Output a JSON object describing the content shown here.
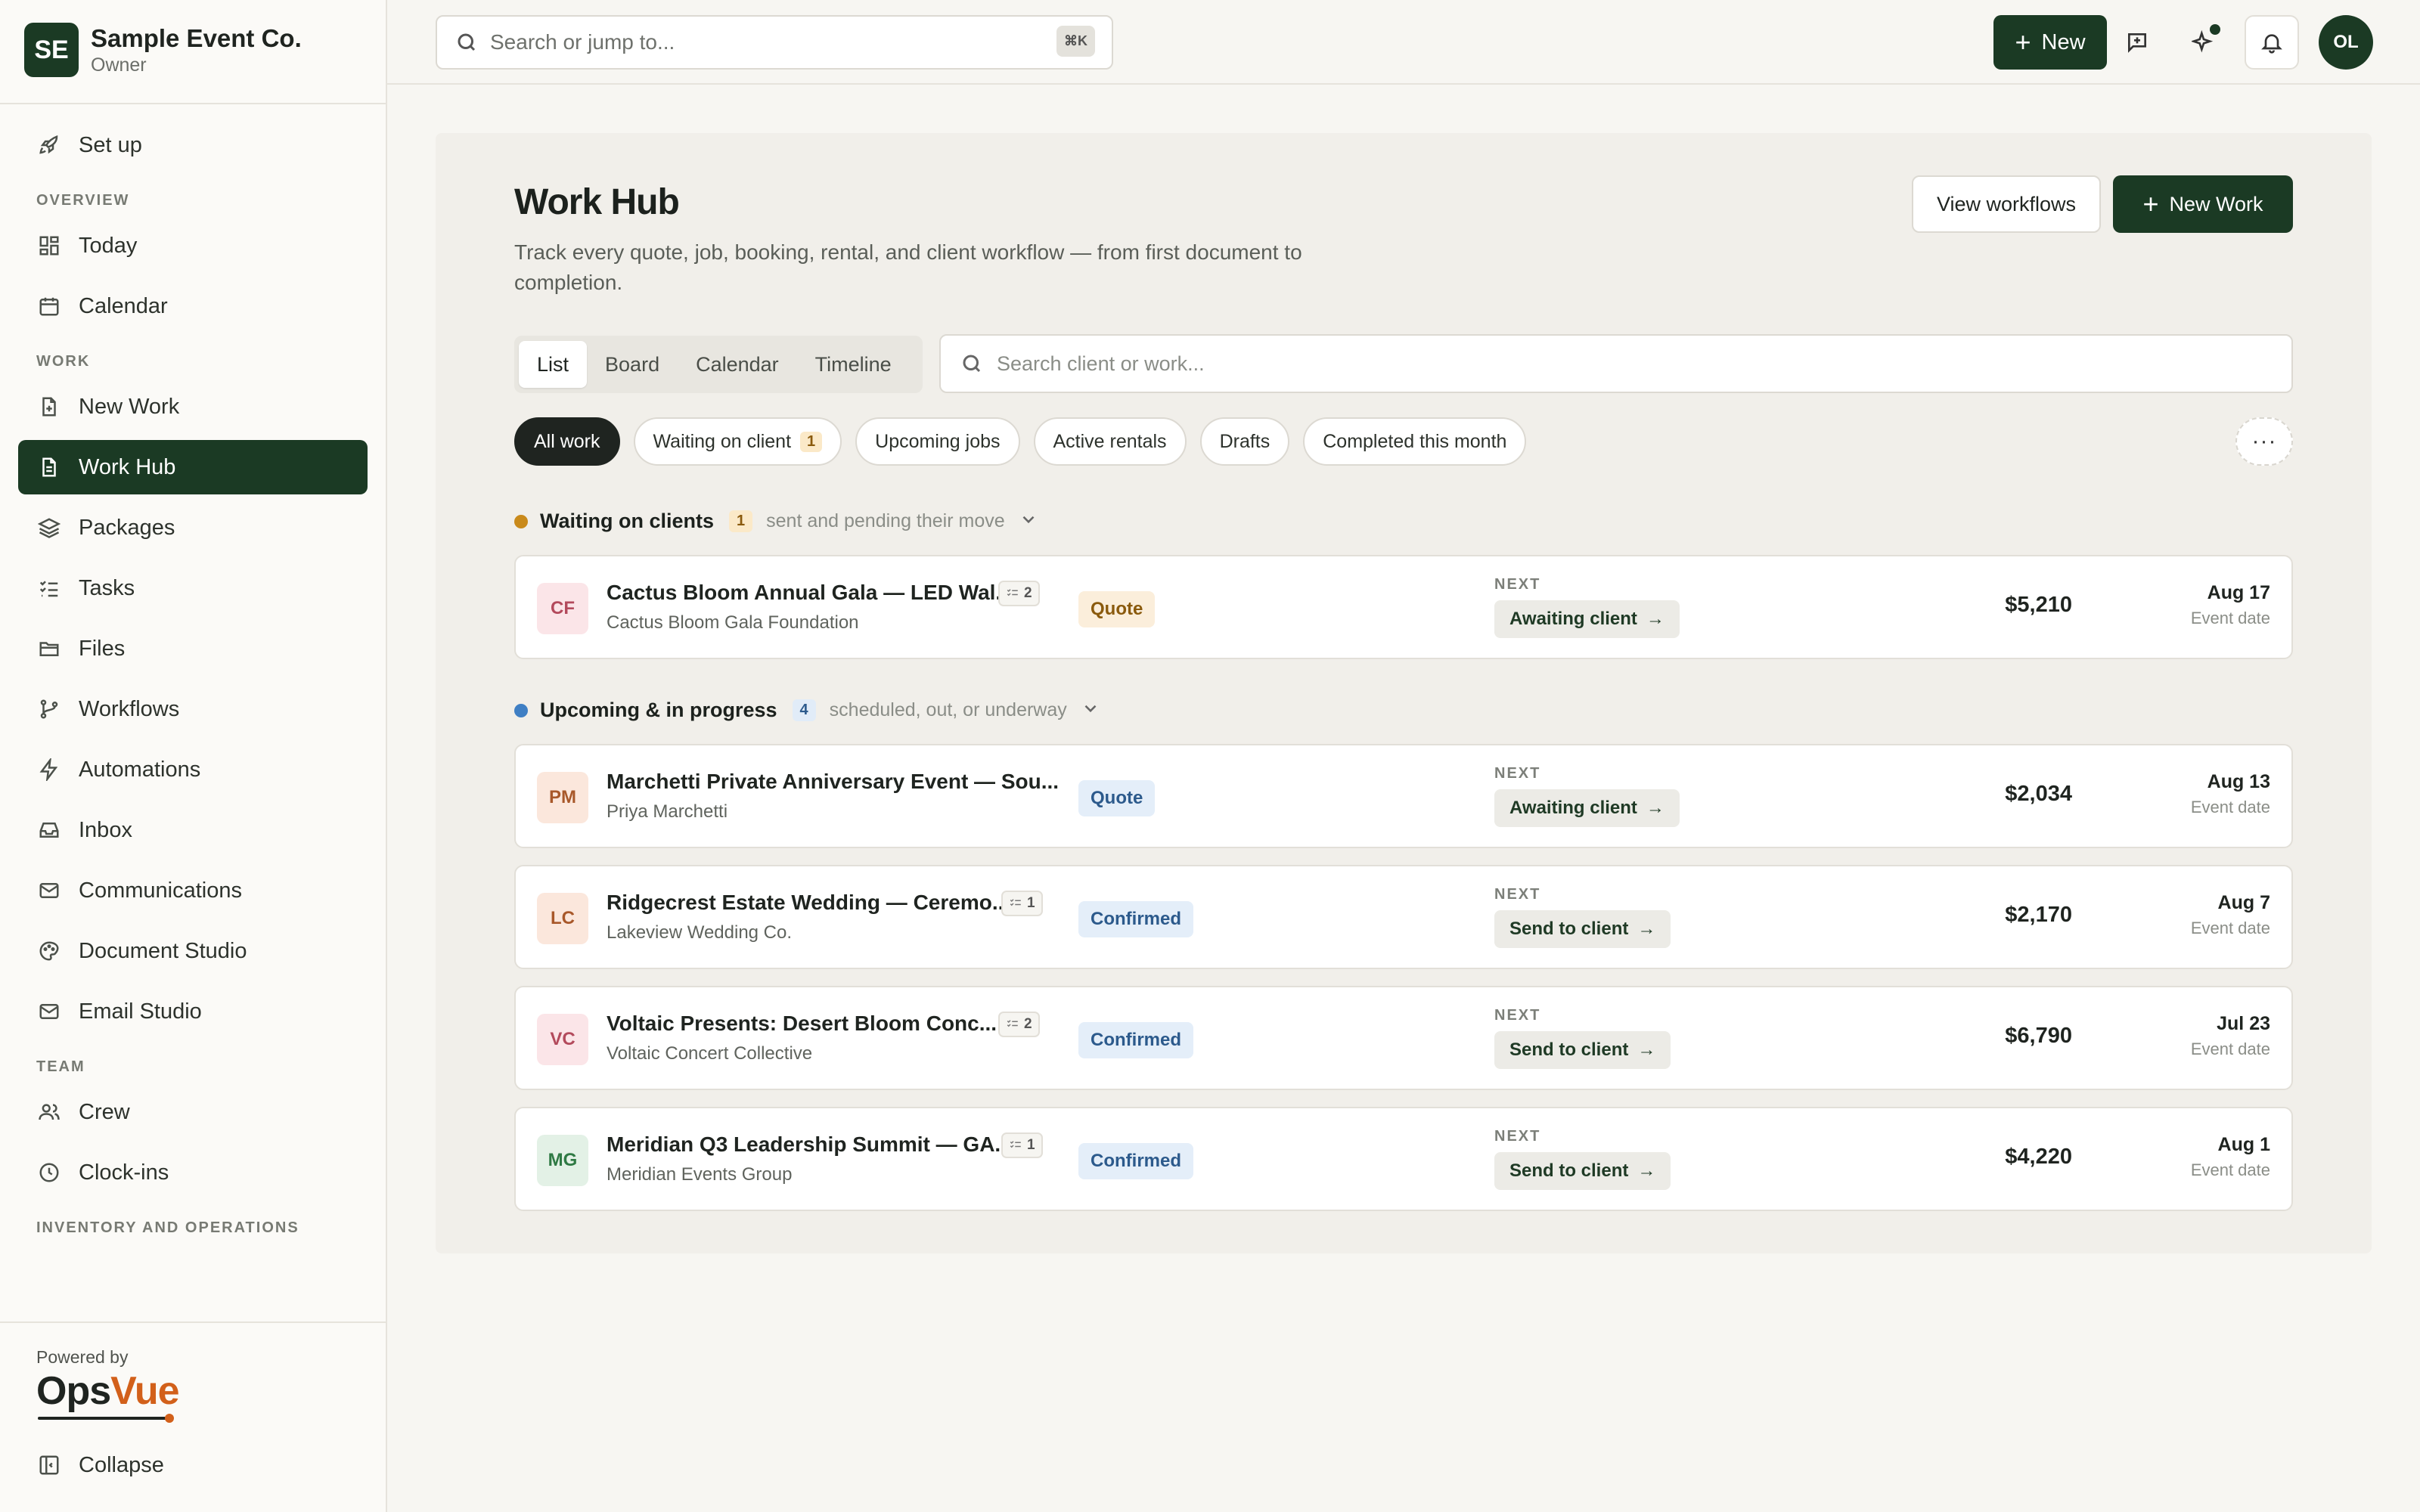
{
  "org": {
    "initials": "SE",
    "name": "Sample Event Co.",
    "role": "Owner"
  },
  "nav": {
    "setup": "Set up",
    "overview_section": "OVERVIEW",
    "today": "Today",
    "calendar": "Calendar",
    "work_section": "WORK",
    "new_work": "New Work",
    "work_hub": "Work Hub",
    "packages": "Packages",
    "tasks": "Tasks",
    "files": "Files",
    "workflows": "Workflows",
    "automations": "Automations",
    "inbox": "Inbox",
    "communications": "Communications",
    "document_studio": "Document Studio",
    "email_studio": "Email Studio",
    "team_section": "TEAM",
    "crew": "Crew",
    "clockins": "Clock-ins",
    "inventory_section": "INVENTORY AND OPERATIONS"
  },
  "footer": {
    "powered_by": "Powered by",
    "brand_a": "Ops",
    "brand_b": "Vue",
    "collapse": "Collapse"
  },
  "topbar": {
    "search_placeholder": "Search or jump to...",
    "shortcut": "⌘K",
    "new_label": "New",
    "avatar_initials": "OL"
  },
  "page": {
    "title": "Work Hub",
    "subtitle": "Track every quote, job, booking, rental, and client workflow — from first document to completion.",
    "view_workflows": "View workflows",
    "new_work": "New Work",
    "view_tabs": [
      "List",
      "Board",
      "Calendar",
      "Timeline"
    ],
    "search_placeholder": "Search client or work...",
    "filters": {
      "all": "All work",
      "waiting": "Waiting on client",
      "waiting_count": "1",
      "upcoming": "Upcoming jobs",
      "rentals": "Active rentals",
      "drafts": "Drafts",
      "completed": "Completed this month"
    }
  },
  "groups": {
    "waiting": {
      "title": "Waiting on clients",
      "count": "1",
      "desc": "sent and pending their move",
      "color": "#c98a1b"
    },
    "upcoming": {
      "title": "Upcoming & in progress",
      "count": "4",
      "desc": "scheduled, out, or underway",
      "color": "#3f7fc4"
    }
  },
  "next_label": "NEXT",
  "date_label": "Event date",
  "rows": [
    {
      "initials": "CF",
      "title": "Cactus Bloom Annual Gala — LED Wal...",
      "client": "Cactus Bloom Gala Foundation",
      "tasks": "2",
      "status": "Quote",
      "next": "Awaiting client",
      "amount": "$5,210",
      "date": "Aug 17"
    },
    {
      "initials": "PM",
      "title": "Marchetti Private Anniversary Event — Sou...",
      "client": "Priya Marchetti",
      "tasks": "",
      "status": "Quote",
      "next": "Awaiting client",
      "amount": "$2,034",
      "date": "Aug 13"
    },
    {
      "initials": "LC",
      "title": "Ridgecrest Estate Wedding — Ceremo...",
      "client": "Lakeview Wedding Co.",
      "tasks": "1",
      "status": "Confirmed",
      "next": "Send to client",
      "amount": "$2,170",
      "date": "Aug 7"
    },
    {
      "initials": "VC",
      "title": "Voltaic Presents: Desert Bloom Conc...",
      "client": "Voltaic Concert Collective",
      "tasks": "2",
      "status": "Confirmed",
      "next": "Send to client",
      "amount": "$6,790",
      "date": "Jul 23"
    },
    {
      "initials": "MG",
      "title": "Meridian Q3 Leadership Summit — GA...",
      "client": "Meridian Events Group",
      "tasks": "1",
      "status": "Confirmed",
      "next": "Send to client",
      "amount": "$4,220",
      "date": "Aug 1"
    }
  ]
}
